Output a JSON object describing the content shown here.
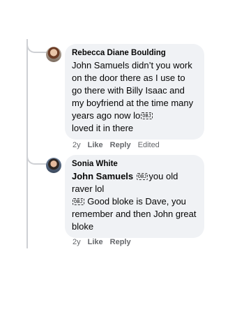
{
  "comments": [
    {
      "author": "Rebecca Diane Boulding",
      "text_part1": "John Samuels didn’t you work on the door there as I use to go there with Billy Isaac and my boyfriend at the time many years ago now lo",
      "obj_glyph": "OBJ",
      "text_part2": "loved it in there",
      "time": "2y",
      "like": "Like",
      "reply": "Reply",
      "edited": "Edited"
    },
    {
      "author": "Sonia White",
      "mention": "John Samuels",
      "obj_glyph": "OBJ",
      "text_part1": "you old raver lol",
      "text_part2": "Good bloke is Dave, you remember and then John great bloke",
      "time": "2y",
      "like": "Like",
      "reply": "Reply"
    }
  ]
}
